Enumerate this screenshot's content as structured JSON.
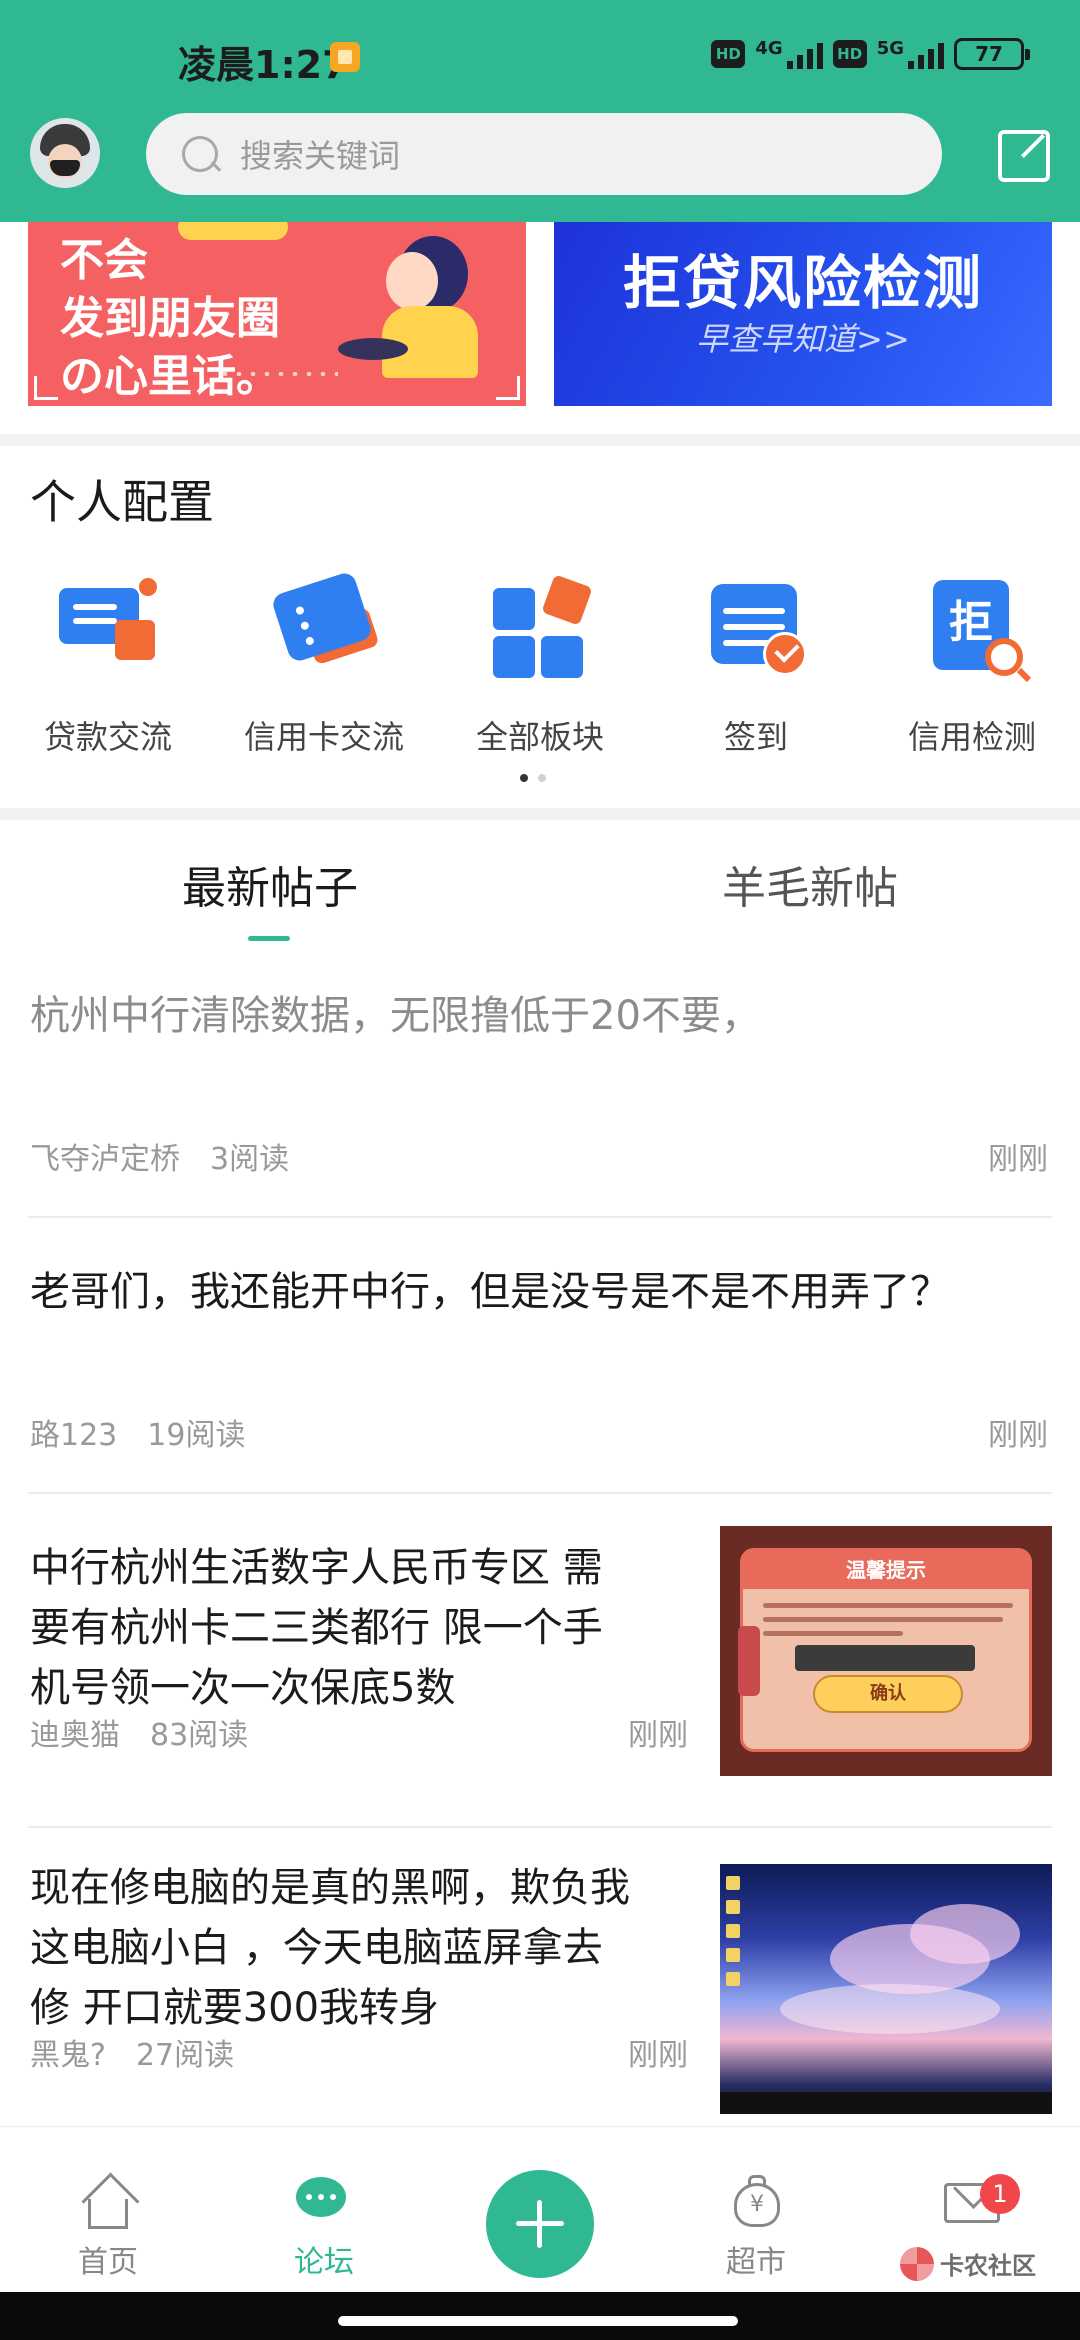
{
  "status_bar": {
    "time": "凌晨1:27",
    "sim1_label": "HD",
    "sim1_network": "4G",
    "sim2_label": "HD",
    "sim2_network": "5G",
    "battery": "77"
  },
  "header": {
    "search_placeholder": "搜索关键词",
    "accent_color": "#30b893"
  },
  "banners": {
    "left_text_line1": "不会",
    "left_text_line2": "发到朋友圈",
    "left_text_line3": "の心里话。",
    "right_title": "拒贷风险检测",
    "right_subtitle": "早查早知道>>"
  },
  "personal_config": {
    "title": "个人配置",
    "items": [
      {
        "label": "贷款交流",
        "icon": "loan-chat-icon"
      },
      {
        "label": "信用卡交流",
        "icon": "credit-card-icon"
      },
      {
        "label": "全部板块",
        "icon": "all-sections-icon"
      },
      {
        "label": "签到",
        "icon": "checkin-calendar-icon"
      },
      {
        "label": "信用检测",
        "icon": "credit-check-icon",
        "glyph": "拒"
      }
    ],
    "page_count": 2,
    "current_page": 1
  },
  "tabs": [
    {
      "label": "最新帖子",
      "active": true
    },
    {
      "label": "羊毛新帖",
      "active": false
    }
  ],
  "posts": [
    {
      "title": "杭州中行清除数据，无限撸低于20不要，",
      "author": "飞夺泸定桥",
      "reads": "3阅读",
      "time": "刚刚",
      "read_state": "visited"
    },
    {
      "title": "老哥们，我还能开中行，但是没号是不是不用弄了？",
      "author": "路123",
      "reads": "19阅读",
      "time": "刚刚"
    },
    {
      "title_line1": "中行杭州生活数字人民币专区 需",
      "title_line2": "要有杭州卡二三类都行 限一个手",
      "title_line3": "机号领一次一次保底5数",
      "author": "迪奥猫",
      "reads": "83阅读",
      "time": "刚刚",
      "thumb": {
        "header": "温馨提示",
        "button": "确认"
      }
    },
    {
      "title_line1": "现在修电脑的是真的黑啊，欺负我",
      "title_line2": "这电脑小白 ，今天电脑蓝屏拿去",
      "title_line3": "修 开口就要300我转身",
      "author": "黑鬼?",
      "reads": "27阅读",
      "time": "刚刚"
    }
  ],
  "bottom_nav": {
    "items": [
      {
        "label": "首页",
        "icon": "home-icon",
        "active": false
      },
      {
        "label": "论坛",
        "icon": "forum-chat-icon",
        "active": true
      },
      {
        "label": "",
        "icon": "plus-icon",
        "active": false
      },
      {
        "label": "超市",
        "icon": "money-bag-icon",
        "active": false
      },
      {
        "label": "",
        "icon": "message-envelope-icon",
        "active": false
      }
    ],
    "message_badge": "1",
    "watermark": "卡农社区"
  }
}
